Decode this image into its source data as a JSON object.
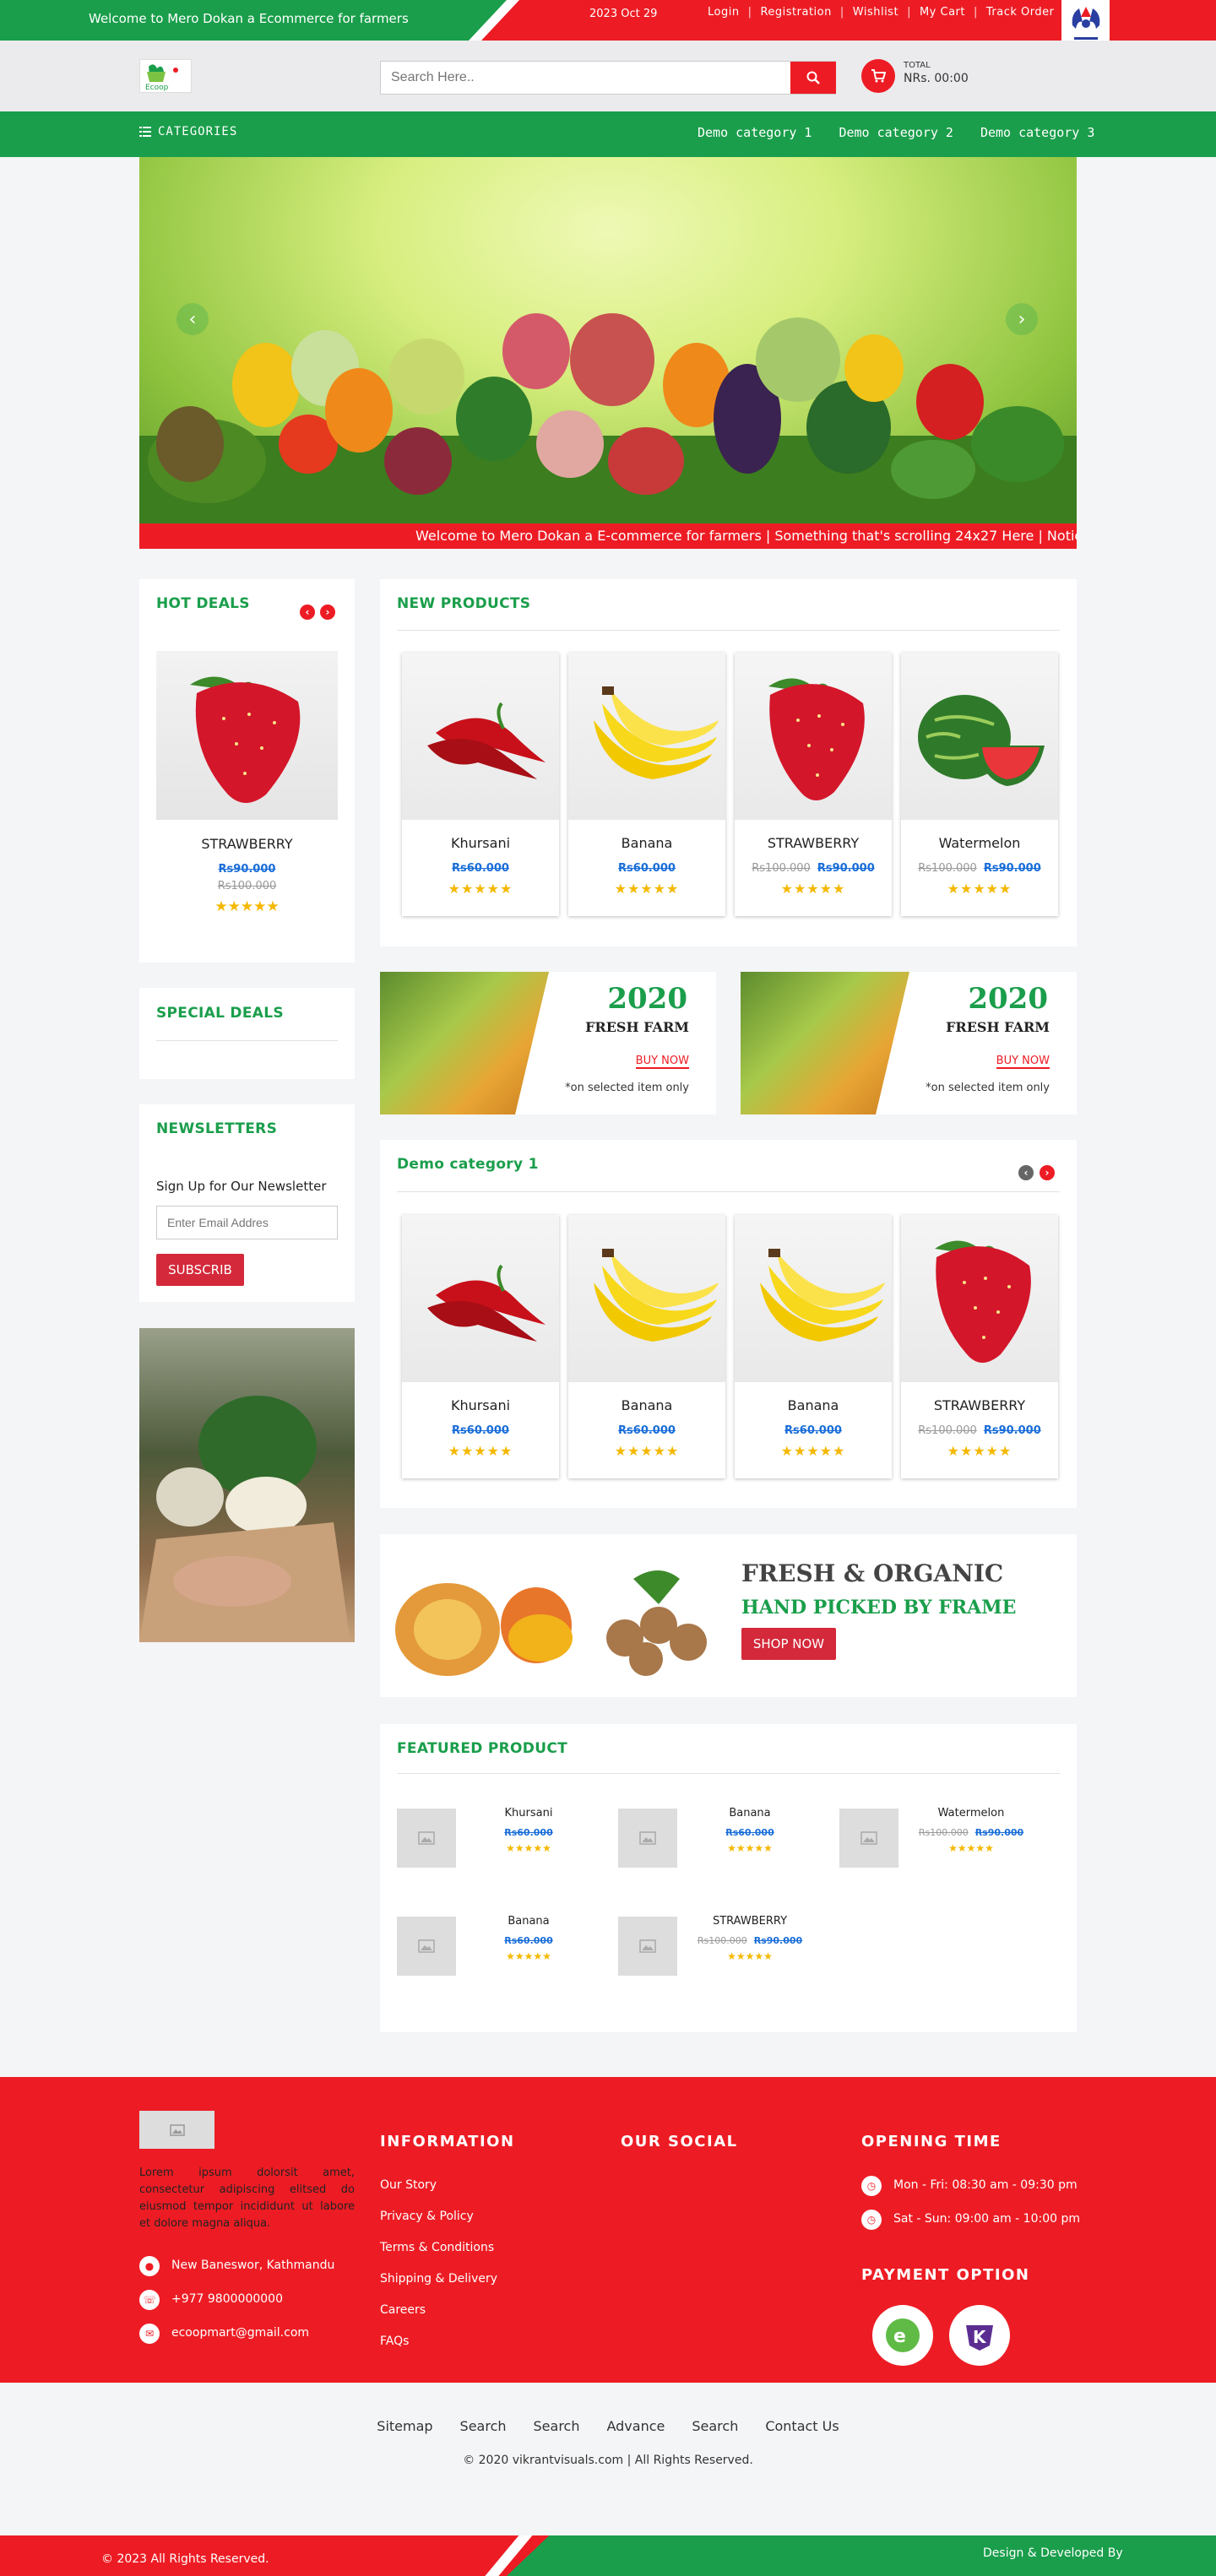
{
  "topbar": {
    "welcome": "Welcome to Mero Dokan a Ecommerce for farmers",
    "date": "2023 Oct 29",
    "links": [
      "Login",
      "Registration",
      "Wishlist",
      "My Cart",
      "Track Order"
    ],
    "separator": "|"
  },
  "header": {
    "logo_alt": "Ecoop",
    "search_placeholder": "Search Here..",
    "cart_label": "TOTAL",
    "cart_total": "NRs. 00:00"
  },
  "nav": {
    "categories_label": "CATEGORIES",
    "links": [
      "Demo category 1",
      "Demo category 2",
      "Demo category 3"
    ]
  },
  "ticker": "Welcome to Mero Dokan a E-commerce for farmers | Something that's scrolling 24x27 Here | Notice, Inf",
  "hot_deals": {
    "title": "HOT DEALS",
    "product": {
      "name": "STRAWBERRY",
      "new_price": "Rs90.000",
      "old_price": "Rs100.000",
      "stars": "★★★★★"
    }
  },
  "special_deals": {
    "title": "SPECIAL DEALS"
  },
  "newsletter": {
    "title": "NEWSLETTERS",
    "label": "Sign Up for Our Newsletter",
    "placeholder": "Enter Email Addres",
    "button": "SUBSCRIB"
  },
  "new_products": {
    "title": "NEW PRODUCTS",
    "items": [
      {
        "name": "Khursani",
        "old_price": "",
        "new_price": "Rs60.000",
        "stars": "★★★★★",
        "img": "chili"
      },
      {
        "name": "Banana",
        "old_price": "",
        "new_price": "Rs60.000",
        "stars": "★★★★★",
        "img": "banana"
      },
      {
        "name": "STRAWBERRY",
        "old_price": "Rs100.000",
        "new_price": "Rs90.000",
        "stars": "★★★★★",
        "img": "strawberry"
      },
      {
        "name": "Watermelon",
        "old_price": "Rs100.000",
        "new_price": "Rs90.000",
        "stars": "★★★★★",
        "img": "watermelon"
      }
    ]
  },
  "promo_banners": [
    {
      "year": "2020",
      "subtitle": "FRESH FARM",
      "button": "BUY NOW",
      "note": "*on selected item only"
    },
    {
      "year": "2020",
      "subtitle": "FRESH FARM",
      "button": "BUY NOW",
      "note": "*on selected item only"
    }
  ],
  "category1": {
    "title": "Demo category 1",
    "items": [
      {
        "name": "Khursani",
        "old_price": "",
        "new_price": "Rs60.000",
        "stars": "★★★★★",
        "img": "chili"
      },
      {
        "name": "Banana",
        "old_price": "",
        "new_price": "Rs60.000",
        "stars": "★★★★★",
        "img": "banana"
      },
      {
        "name": "Banana",
        "old_price": "",
        "new_price": "Rs60.000",
        "stars": "★★★★★",
        "img": "banana"
      },
      {
        "name": "STRAWBERRY",
        "old_price": "Rs100.000",
        "new_price": "Rs90.000",
        "stars": "★★★★★",
        "img": "strawberry"
      }
    ]
  },
  "organic": {
    "title": "FRESH & ORGANIC",
    "subtitle": "HAND PICKED BY FRAME",
    "button": "SHOP NOW"
  },
  "featured": {
    "title": "FEATURED PRODUCT",
    "items": [
      {
        "name": "Khursani",
        "old_price": "",
        "new_price": "Rs60.000",
        "stars": "★★★★★"
      },
      {
        "name": "Banana",
        "old_price": "",
        "new_price": "Rs60.000",
        "stars": "★★★★★"
      },
      {
        "name": "Watermelon",
        "old_price": "Rs100.000",
        "new_price": "Rs90.000",
        "stars": "★★★★★"
      },
      {
        "name": "Banana",
        "old_price": "",
        "new_price": "Rs60.000",
        "stars": "★★★★★"
      },
      {
        "name": "STRAWBERRY",
        "old_price": "Rs100.000",
        "new_price": "Rs90.000",
        "stars": "★★★★★"
      }
    ]
  },
  "footer": {
    "about": "Lorem ipsum dolorsit amet, consectetur adipiscing elitsed do eiusmod tempor incididunt ut labore et dolore magna aliqua.",
    "address": "New Baneswor, Kathmandu",
    "phone": "+977 9800000000",
    "email": "ecoopmart@gmail.com",
    "information_title": "INFORMATION",
    "information_links": [
      "Our Story",
      "Privacy & Policy",
      "Terms & Conditions",
      "Shipping & Delivery",
      "Careers",
      "FAQs"
    ],
    "social_title": "OUR SOCIAL",
    "opening_title": "OPENING TIME",
    "opening_hours": [
      "Mon - Fri: 08:30 am - 09:30 pm",
      "Sat - Sun: 09:00 am - 10:00 pm"
    ],
    "payment_title": "PAYMENT OPTION",
    "payment_methods": [
      "esewa",
      "khalti"
    ]
  },
  "bottom_links": [
    "Sitemap",
    "Search",
    "Search",
    "Advance",
    "Search",
    "Contact Us"
  ],
  "copyright": "© 2020 vikrantvisuals.com | All Rights Reserved.",
  "bottombar": {
    "rights": "© 2023 All Rights Reserved.",
    "credit": "Design & Developed By"
  },
  "colors": {
    "green": "#1a9e4b",
    "red": "#ed1c24",
    "price_blue": "#1a6ed8",
    "star": "#f5b800"
  }
}
